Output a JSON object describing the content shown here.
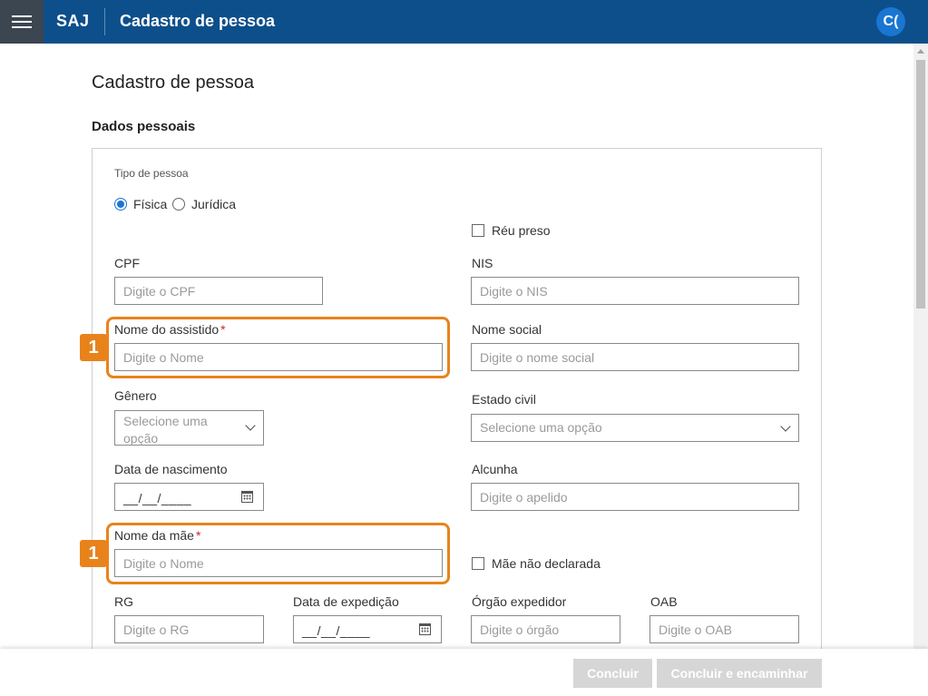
{
  "header": {
    "brand": "SAJ",
    "title": "Cadastro de pessoa",
    "avatar_initials": "C("
  },
  "page": {
    "title": "Cadastro de pessoa",
    "section_title": "Dados pessoais"
  },
  "form": {
    "tipo_pessoa": {
      "label": "Tipo de pessoa",
      "options": [
        "Física",
        "Jurídica"
      ],
      "selected": "Física"
    },
    "reu_preso": {
      "label": "Réu preso",
      "checked": false
    },
    "cpf": {
      "label": "CPF",
      "placeholder": "Digite o CPF",
      "value": ""
    },
    "nis": {
      "label": "NIS",
      "placeholder": "Digite o NIS",
      "value": ""
    },
    "nome_assistido": {
      "label": "Nome do assistido",
      "required_mark": "*",
      "placeholder": "Digite o Nome",
      "value": ""
    },
    "nome_social": {
      "label": "Nome social",
      "placeholder": "Digite o nome social",
      "value": ""
    },
    "genero": {
      "label": "Gênero",
      "selected": "Selecione uma opção"
    },
    "estado_civil": {
      "label": "Estado civil",
      "selected": "Selecione uma opção"
    },
    "data_nascimento": {
      "label": "Data de nascimento",
      "mask": "__/__/____"
    },
    "alcunha": {
      "label": "Alcunha",
      "placeholder": "Digite o apelido",
      "value": ""
    },
    "nome_mae": {
      "label": "Nome da mãe",
      "required_mark": "*",
      "placeholder": "Digite o Nome",
      "value": ""
    },
    "mae_nao_declarada": {
      "label": "Mãe não declarada",
      "checked": false
    },
    "rg": {
      "label": "RG",
      "placeholder": "Digite o RG",
      "value": ""
    },
    "data_expedicao": {
      "label": "Data de expedição",
      "mask": "__/__/____"
    },
    "orgao_expedidor": {
      "label": "Órgão expedidor",
      "placeholder": "Digite o órgão",
      "value": ""
    },
    "oab": {
      "label": "OAB",
      "placeholder": "Digite o OAB",
      "value": ""
    }
  },
  "annotations": {
    "marker_1": "1",
    "marker_2": "1",
    "highlight_color": "#e8831c"
  },
  "footer": {
    "concluir": "Concluir",
    "concluir_encaminhar": "Concluir e encaminhar"
  },
  "colors": {
    "header_bg": "#0d4f8b",
    "accent": "#1976d2",
    "disabled_button": "#d6d6d6"
  }
}
